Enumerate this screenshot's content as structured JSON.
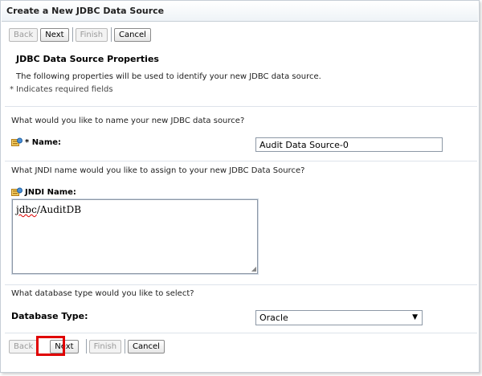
{
  "window": {
    "title": "Create a New JDBC Data Source"
  },
  "buttons": {
    "back": "Back",
    "next": "Next",
    "finish": "Finish",
    "cancel": "Cancel"
  },
  "section": {
    "title": "JDBC Data Source Properties",
    "description": "The following properties will be used to identify your new JDBC data source.",
    "required_note": "* Indicates required fields"
  },
  "name_field": {
    "question": "What would you like to name your new JDBC data source?",
    "label": "* Name:",
    "value": "Audit Data Source-0",
    "icon": "database-icon"
  },
  "jndi_field": {
    "question": "What JNDI name would you like to assign to your new JDBC Data Source?",
    "label": "JNDI Name:",
    "value_prefix": "jdbc",
    "value_suffix": "/AuditDB",
    "icon": "database-icon"
  },
  "db_type": {
    "question": "What database type would you like to select?",
    "label": "Database Type:",
    "selected": "Oracle"
  },
  "colors": {
    "highlight": "#e00000",
    "border": "#c6ced6"
  }
}
